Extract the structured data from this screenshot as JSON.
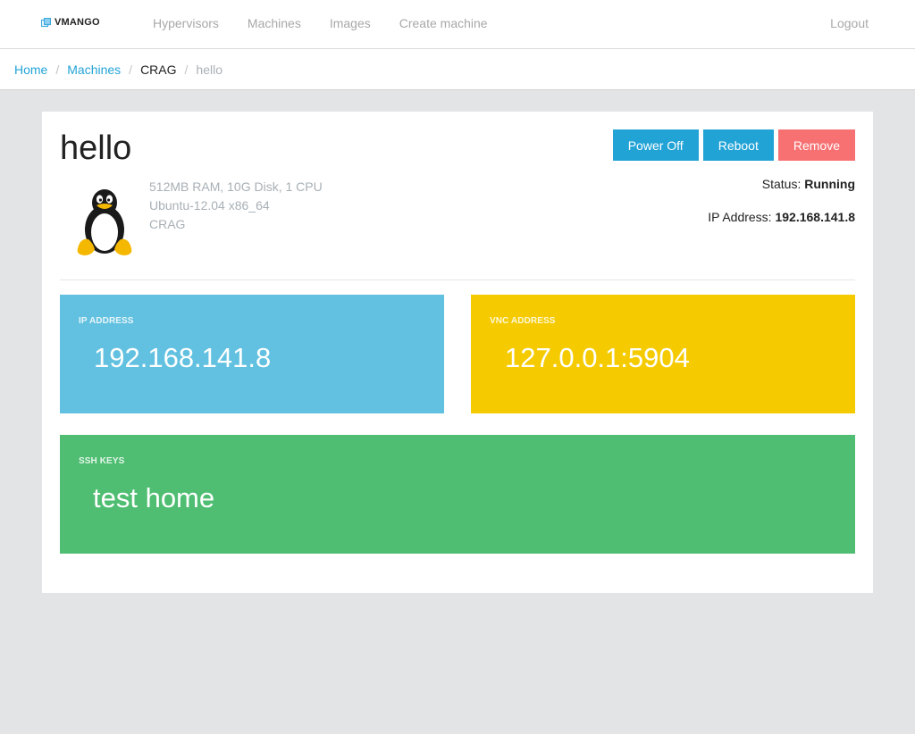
{
  "nav": {
    "brand": "VMANGO",
    "links": [
      "Hypervisors",
      "Machines",
      "Images",
      "Create machine"
    ],
    "logout": "Logout"
  },
  "breadcrumb": {
    "home": "Home",
    "machines": "Machines",
    "hypervisor": "CRAG",
    "current": "hello",
    "separator": "/"
  },
  "vm": {
    "name": "hello",
    "specs": "512MB RAM, 10G Disk, 1 CPU",
    "os": "Ubuntu-12.04 x86_64",
    "hypervisor": "CRAG",
    "os_icon": "linux-tux-icon"
  },
  "actions": {
    "power_off": "Power Off",
    "reboot": "Reboot",
    "remove": "Remove"
  },
  "status": {
    "label": "Status:",
    "value": "Running",
    "ip_label": "IP Address:",
    "ip_value": "192.168.141.8"
  },
  "tiles": {
    "ip": {
      "label": "IP ADDRESS",
      "value": "192.168.141.8"
    },
    "vnc": {
      "label": "VNC ADDRESS",
      "value": "127.0.0.1:5904"
    },
    "ssh": {
      "label": "SSH KEYS",
      "value": "test home"
    }
  },
  "colors": {
    "accent_blue": "#22a3d6",
    "remove_red": "#f77072",
    "tile_ip": "#62c1e0",
    "tile_vnc": "#f5cb00",
    "tile_ssh": "#4fbe72"
  }
}
